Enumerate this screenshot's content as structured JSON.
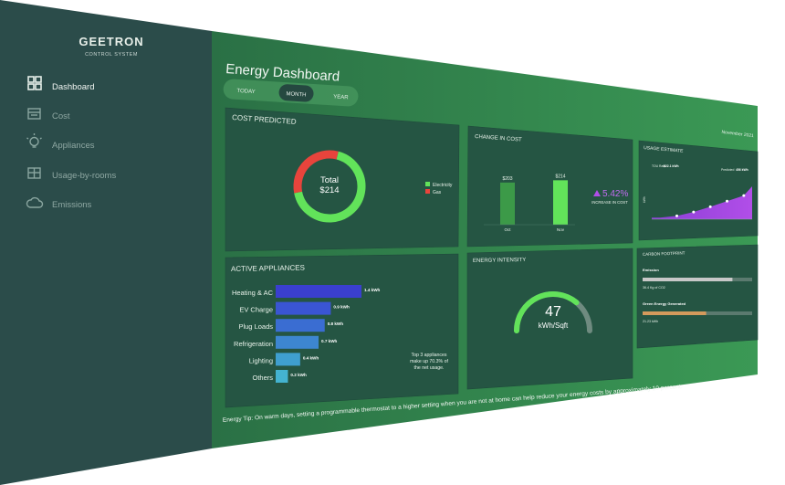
{
  "brand": {
    "name": "GEETRON",
    "tagline": "CONTROL SYSTEM"
  },
  "sidebar": {
    "items": [
      {
        "label": "Dashboard",
        "icon": "dashboard-icon",
        "active": true
      },
      {
        "label": "Cost",
        "icon": "calendar-icon",
        "active": false
      },
      {
        "label": "Appliances",
        "icon": "bulb-icon",
        "active": false
      },
      {
        "label": "Usage-by-rooms",
        "icon": "rooms-icon",
        "active": false
      },
      {
        "label": "Emissions",
        "icon": "cloud-icon",
        "active": false
      }
    ]
  },
  "header": {
    "title": "Energy Dashboard",
    "tabs": [
      {
        "label": "TODAY",
        "active": false
      },
      {
        "label": "MONTH",
        "active": true
      },
      {
        "label": "YEAR",
        "active": false
      }
    ],
    "date": "November 2021"
  },
  "cost_predicted": {
    "title": "COST PREDICTED",
    "total_label": "Total",
    "total_value": "$214",
    "legend": [
      {
        "label": "Electricity",
        "color": "#62e35a"
      },
      {
        "label": "Gas",
        "color": "#e8443c"
      }
    ],
    "chart_data": {
      "type": "pie",
      "categories": [
        "Electricity",
        "Gas"
      ],
      "values": [
        0.68,
        0.32
      ]
    }
  },
  "change_in_cost": {
    "title": "CHANGE IN COST",
    "change_value": "5.42%",
    "change_caption": "INCREASE IN COST",
    "chart_data": {
      "type": "bar",
      "categories": [
        "Oct",
        "Nov"
      ],
      "values": [
        203,
        214
      ],
      "data_labels": [
        "$203",
        "$214"
      ]
    }
  },
  "usage_estimate": {
    "title": "USAGE ESTIMATE",
    "legend_left": "TOU Rate",
    "legend_left_value": "$22.1 kWh",
    "legend_right": "Predicted",
    "legend_right_value": "456 kWh",
    "ylabel": "kWh",
    "chart_data": {
      "type": "area",
      "values": [
        0.05,
        0.1,
        0.22,
        0.38,
        0.55,
        0.72
      ],
      "peak": 1.0
    }
  },
  "active_appliances": {
    "title": "ACTIVE APPLIANCES",
    "note": "Top 3 appliances make up 70.3% of the net usage.",
    "chart_data": {
      "type": "bar",
      "categories": [
        "Heating & AC",
        "EV Charge",
        "Plug Loads",
        "Refrigeration",
        "Lighting",
        "Others"
      ],
      "values": [
        1.4,
        0.9,
        0.8,
        0.7,
        0.4,
        0.2
      ],
      "data_labels": [
        "1.4 kWh",
        "0.9 kWh",
        "0.8 kWh",
        "0.7 kWh",
        "0.4 kWh",
        "0.2 kWh"
      ]
    }
  },
  "energy_intensity": {
    "title": "ENERGY INTENSITY",
    "value": "47",
    "unit": "kWh/Sqft",
    "fraction": 0.72
  },
  "carbon_footprint": {
    "title": "CARBON FOOTPRINT",
    "rows": [
      {
        "label": "Emission",
        "value": "36.4 Kg of CO2",
        "fraction": 0.82,
        "color": "#c8c8c8"
      },
      {
        "label": "Green Energy Generated",
        "value": "21.23 kWh",
        "fraction": 0.58,
        "color": "#d49a5c"
      }
    ]
  },
  "tip": {
    "text": "Energy Tip: On warm days, setting a programmable thermostat to a higher setting when you are not at home can help reduce your energy costs by approximately 10 percent."
  }
}
